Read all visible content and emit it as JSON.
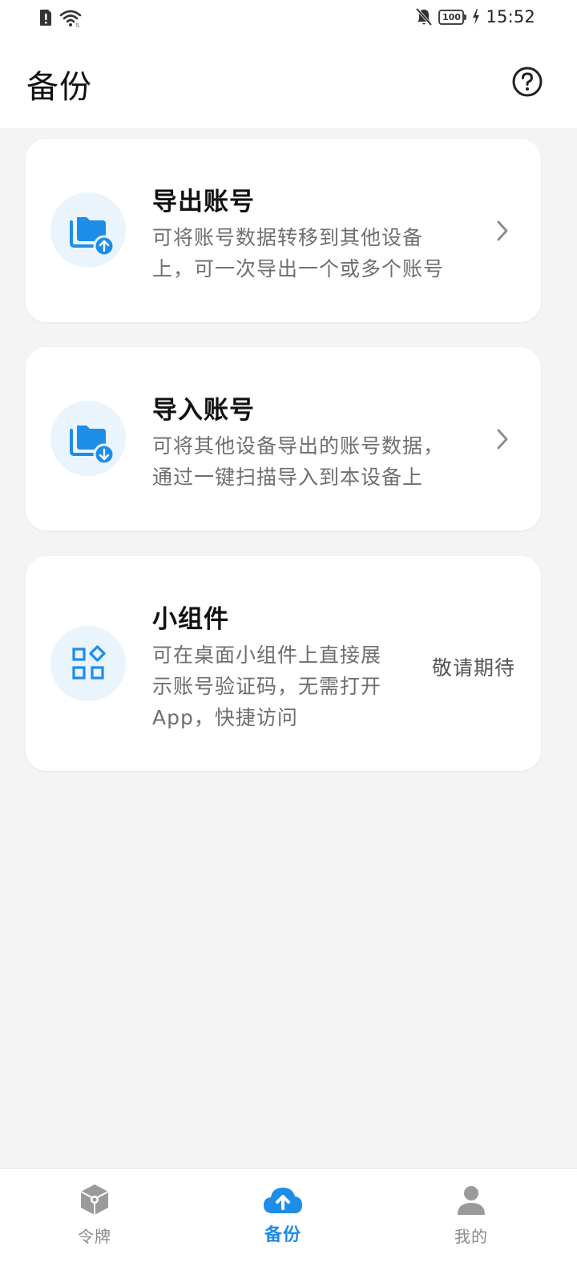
{
  "status_bar": {
    "time": "15:52",
    "battery": "100",
    "icons": [
      "sim-alert-icon",
      "wifi-icon",
      "bell-muted-icon",
      "battery-icon",
      "charging-bolt-icon"
    ]
  },
  "header": {
    "title": "备份",
    "help_icon": "help-circle-icon"
  },
  "cards": [
    {
      "title": "导出账号",
      "desc_lines": [
        "可将账号数据转移到其他设备",
        "上，可一次导出一个或多个账号"
      ],
      "icon": "folder-upload-icon",
      "action": "chevron-right-icon"
    },
    {
      "title": "导入账号",
      "desc_lines": [
        "可将其他设备导出的账号数据，",
        "通过一键扫描导入到本设备上"
      ],
      "icon": "folder-download-icon",
      "action": "chevron-right-icon"
    },
    {
      "title": "小组件",
      "desc_lines": [
        "可在桌面小组件上直接展",
        "示账号验证码，无需打开",
        "App，快捷访问"
      ],
      "icon": "widgets-icon",
      "status": "敬请期待"
    }
  ],
  "bottom_nav": {
    "items": [
      {
        "label": "令牌",
        "icon": "token-cube-icon",
        "active": false
      },
      {
        "label": "备份",
        "icon": "cloud-upload-icon",
        "active": true
      },
      {
        "label": "我的",
        "icon": "person-icon",
        "active": false
      }
    ]
  },
  "colors": {
    "accent": "#1e8de8",
    "icon_bg": "#e9f4fd",
    "page_bg": "#f4f4f4",
    "text_secondary": "#6f6f6f"
  }
}
